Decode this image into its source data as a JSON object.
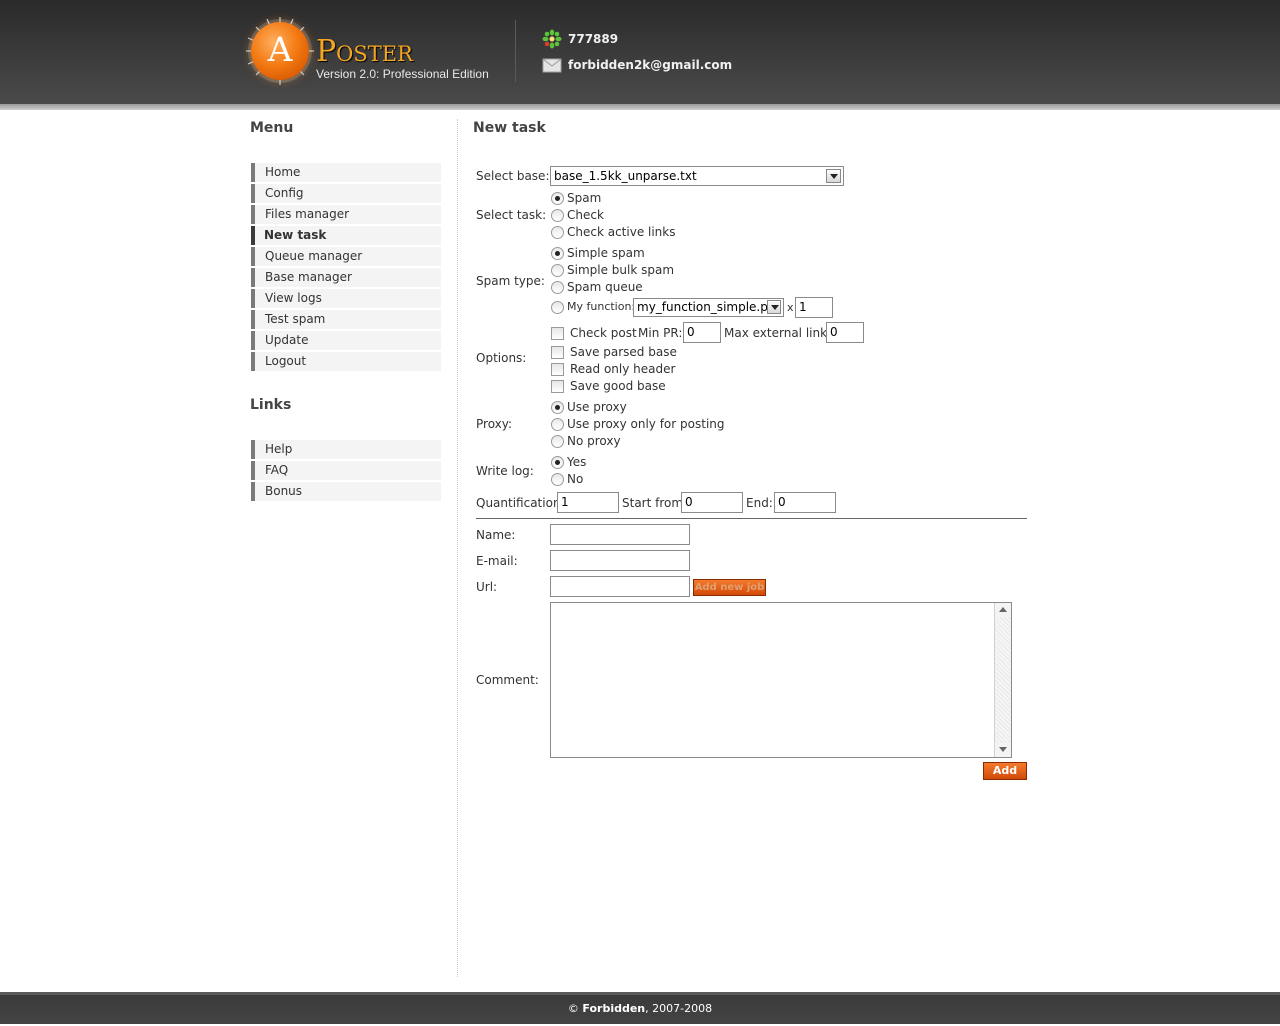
{
  "header": {
    "logo_letter": "A",
    "logo_name": "Poster",
    "version": "Version 2.0: Professional Edition",
    "icq_number": "777889",
    "email": "forbidden2k@gmail.com",
    "icq_icon": "icq-flower-icon",
    "email_icon": "envelope-icon"
  },
  "sidebar": {
    "menu_title": "Menu",
    "menu_items": [
      "Home",
      "Config",
      "Files manager",
      "New task",
      "Queue manager",
      "Base manager",
      "View logs",
      "Test spam",
      "Update",
      "Logout"
    ],
    "active_item": "New task",
    "links_title": "Links",
    "link_items": [
      "Help",
      "FAQ",
      "Bonus"
    ]
  },
  "main": {
    "title": "New task",
    "select_base": {
      "label": "Select base:",
      "value": "base_1.5kk_unparse.txt"
    },
    "select_task": {
      "label": "Select task:",
      "options": [
        "Spam",
        "Check",
        "Check active links"
      ],
      "selected": "Spam"
    },
    "spam_type": {
      "label": "Spam type:",
      "options": [
        "Simple spam",
        "Simple bulk spam",
        "Spam queue",
        "My function:"
      ],
      "selected": "Simple spam",
      "function_value": "my_function_simple.pl",
      "multiplier_symbol": "x",
      "multiplier_value": "1"
    },
    "options": {
      "label": "Options:",
      "check_post": "Check post",
      "min_pr_label": "Min PR:",
      "min_pr_value": "0",
      "max_links_label": "Max external links:",
      "max_links_value": "0",
      "save_parsed": "Save parsed base",
      "read_only_header": "Read only header",
      "save_good": "Save good base"
    },
    "proxy": {
      "label": "Proxy:",
      "options": [
        "Use proxy",
        "Use proxy only for posting",
        "No proxy"
      ],
      "selected": "Use proxy"
    },
    "write_log": {
      "label": "Write log:",
      "options": [
        "Yes",
        "No"
      ],
      "selected": "Yes"
    },
    "quantification": {
      "label": "Quantification:",
      "value": "1",
      "start_label": "Start from:",
      "start_value": "0",
      "end_label": "End:",
      "end_value": "0"
    },
    "name_label": "Name:",
    "email_label": "E-mail:",
    "url_label": "Url:",
    "add_new_job_label": "Add new job",
    "comment_label": "Comment:",
    "add_button": "Add"
  },
  "footer": {
    "copyright_symbol": "©",
    "author": "Forbidden",
    "years": ", 2007-2008"
  }
}
